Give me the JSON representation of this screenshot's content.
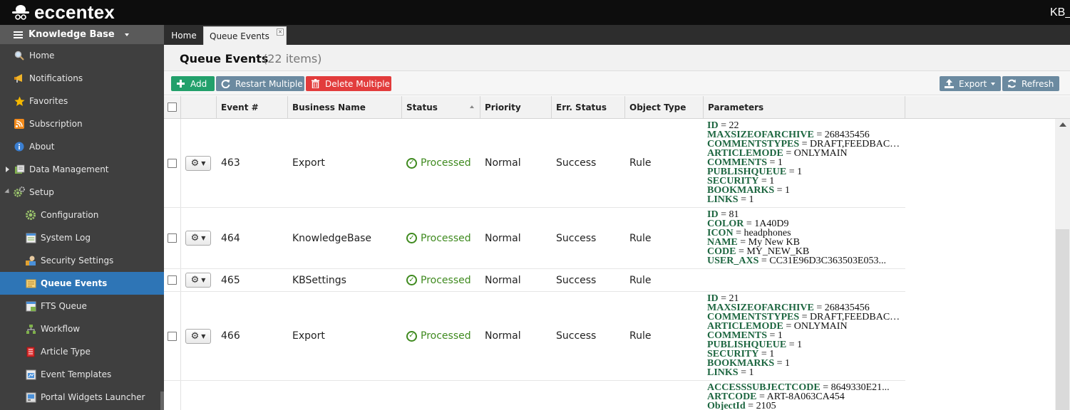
{
  "app": {
    "brand": "eccentex",
    "user": "KB_"
  },
  "sidebar": {
    "header": "Knowledge Base",
    "items": [
      {
        "label": "Home",
        "icon": "magnifier-icon"
      },
      {
        "label": "Notifications",
        "icon": "megaphone-icon"
      },
      {
        "label": "Favorites",
        "icon": "star-icon"
      },
      {
        "label": "Subscription",
        "icon": "rss-icon"
      },
      {
        "label": "About",
        "icon": "info-icon"
      },
      {
        "label": "Data Management",
        "icon": "database-icon"
      },
      {
        "label": "Setup",
        "icon": "gears-icon"
      },
      {
        "label": "Configuration",
        "icon": "gear-icon"
      },
      {
        "label": "System Log",
        "icon": "log-icon"
      },
      {
        "label": "Security Settings",
        "icon": "security-icon"
      },
      {
        "label": "Queue Events",
        "icon": "queue-icon"
      },
      {
        "label": "FTS Queue",
        "icon": "fts-icon"
      },
      {
        "label": "Workflow",
        "icon": "workflow-icon"
      },
      {
        "label": "Article Type",
        "icon": "article-icon"
      },
      {
        "label": "Event Templates",
        "icon": "template-icon"
      },
      {
        "label": "Portal Widgets Launcher",
        "icon": "widgets-icon"
      }
    ]
  },
  "tabs": {
    "home": "Home",
    "current": "Queue Events"
  },
  "page": {
    "title": "Queue Events",
    "count": "(22 items)"
  },
  "toolbar": {
    "add": "Add",
    "restart": "Restart Multiple",
    "delete": "Delete Multiple",
    "export": "Export",
    "refresh": "Refresh"
  },
  "columns": [
    "Event #",
    "Business Name",
    "Status",
    "Priority",
    "Err. Status",
    "Object Type",
    "Parameters"
  ],
  "rows": [
    {
      "event": "463",
      "business": "Export",
      "status": "Processed",
      "priority": "Normal",
      "err": "Success",
      "object": "Rule",
      "params": [
        [
          "ID",
          " = 22"
        ],
        [
          "MAXSIZEOFARCHIVE",
          " = 268435456"
        ],
        [
          "COMMENTSTYPES",
          " = DRAFT,FEEDBACK,..."
        ],
        [
          "ARTICLEMODE",
          " = ONLYMAIN"
        ],
        [
          "COMMENTS",
          " = 1"
        ],
        [
          "PUBLISHQUEUE",
          " = 1"
        ],
        [
          "SECURITY",
          " = 1"
        ],
        [
          "BOOKMARKS",
          " = 1"
        ],
        [
          "LINKS",
          " = 1"
        ]
      ]
    },
    {
      "event": "464",
      "business": "KnowledgeBase",
      "status": "Processed",
      "priority": "Normal",
      "err": "Success",
      "object": "Rule",
      "params": [
        [
          "ID",
          " = 81"
        ],
        [
          "COLOR",
          " = 1A40D9"
        ],
        [
          "ICON",
          " = headphones"
        ],
        [
          "NAME",
          " = My New KB"
        ],
        [
          "CODE",
          " = MY_NEW_KB"
        ],
        [
          "USER_AXS",
          " = CC31E96D3C363503E053..."
        ]
      ]
    },
    {
      "event": "465",
      "business": "KBSettings",
      "status": "Processed",
      "priority": "Normal",
      "err": "Success",
      "object": "Rule",
      "params": []
    },
    {
      "event": "466",
      "business": "Export",
      "status": "Processed",
      "priority": "Normal",
      "err": "Success",
      "object": "Rule",
      "params": [
        [
          "ID",
          " = 21"
        ],
        [
          "MAXSIZEOFARCHIVE",
          " = 268435456"
        ],
        [
          "COMMENTSTYPES",
          " = DRAFT,FEEDBACK,..."
        ],
        [
          "ARTICLEMODE",
          " = ONLYMAIN"
        ],
        [
          "COMMENTS",
          " = 1"
        ],
        [
          "PUBLISHQUEUE",
          " = 1"
        ],
        [
          "SECURITY",
          " = 1"
        ],
        [
          "BOOKMARKS",
          " = 1"
        ],
        [
          "LINKS",
          " = 1"
        ]
      ]
    },
    {
      "event": "",
      "business": "",
      "status": "",
      "priority": "",
      "err": "",
      "object": "",
      "params": [
        [
          "ACCESSSUBJECTCODE",
          " = 8649330E21..."
        ],
        [
          "ARTCODE",
          " = ART-8A063CA454"
        ],
        [
          "ObjectId",
          " = 2105"
        ]
      ]
    }
  ],
  "colors": {
    "accent": "#2e75b6",
    "add": "#22a06b",
    "delete": "#e23c3c",
    "neutral": "#6b8aa0",
    "success": "#3f8a1f",
    "paramKey": "#1d6640"
  }
}
